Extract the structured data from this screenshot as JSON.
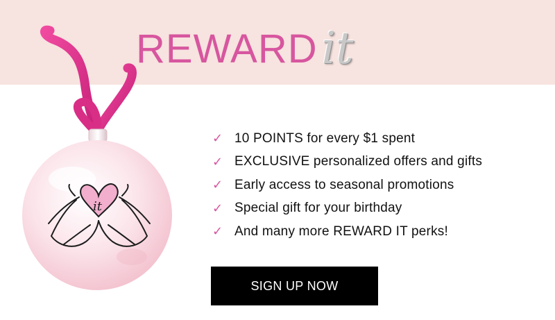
{
  "brand": {
    "wordmark": "REWARD",
    "logo_script": "it",
    "accent_color": "#d7569f"
  },
  "ornament": {
    "icon": "heart-hands-ornament",
    "logo_text": "it",
    "ribbon_color": "#e0358f"
  },
  "benefits": [
    {
      "icon": "check-icon",
      "mark": "✓",
      "text": "10 POINTS for every $1 spent"
    },
    {
      "icon": "check-icon",
      "mark": "✓",
      "text": "EXCLUSIVE personalized offers and gifts"
    },
    {
      "icon": "check-icon",
      "mark": "✓",
      "text": "Early access to seasonal promotions"
    },
    {
      "icon": "check-icon",
      "mark": "✓",
      "text": "Special gift for your birthday"
    },
    {
      "icon": "check-icon",
      "mark": "✓",
      "text": "And many more REWARD IT perks!"
    }
  ],
  "cta": {
    "label": "SIGN UP NOW"
  }
}
